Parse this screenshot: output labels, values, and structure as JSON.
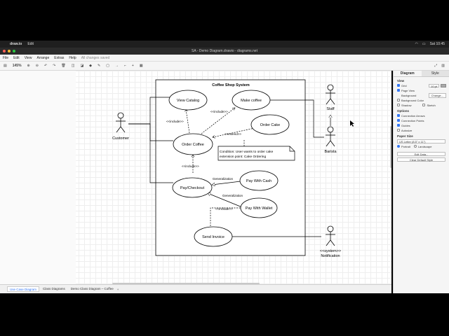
{
  "menubar": {
    "app_name": "draw.io",
    "edit": "Edit",
    "status_time": "Sat 10:45"
  },
  "window": {
    "title": "SA - Demo Diagram.drawio - diagrams.net"
  },
  "app_menu": {
    "items": [
      "File",
      "Edit",
      "View",
      "Arrange",
      "Extras",
      "Help"
    ],
    "saved": "All changes saved"
  },
  "toolbar": {
    "zoom": "145%"
  },
  "diagram": {
    "system_title": "Coffee Shop System",
    "actors": {
      "customer": "Customer",
      "staff": "Staff",
      "barista": "Barista",
      "notification_stereotype": "<<system>>",
      "notification": "Notification"
    },
    "use_cases": {
      "view_catalog": "View Catalog",
      "make_coffee": "Make coffee",
      "order_cake": "Order Cake",
      "order_coffee": "Order Coffee",
      "pay_checkout": "Pay/Checkout",
      "pay_cash": "Pay With Cash",
      "pay_wallet": "Pay With Wallet",
      "send_invoice": "Send Invoice"
    },
    "labels": {
      "include1": "<<include>>",
      "include2": "<<include>>",
      "extend": "<<extend>>",
      "include3": "<<include>>",
      "generalization1": "Generalization",
      "generalization2": "Generalization",
      "include4": "<<include>>"
    },
    "note": {
      "line1": "Condition: User wants to order cake",
      "line2": "extension point: Cake Ordering"
    }
  },
  "panel": {
    "tab_diagram": "Diagram",
    "tab_style": "Style",
    "view_heading": "View",
    "grid": "Grid",
    "grid_value": "10 pt",
    "page_view": "Page View",
    "background": "Background",
    "change": "Change...",
    "background_color": "Background Color",
    "shadow": "Shadow",
    "sketch": "Sketch",
    "options_heading": "Options",
    "connection_arrows": "Connection Arrows",
    "connection_points": "Connection Points",
    "guides": "Guides",
    "autosize": "Autosize",
    "paper_heading": "Paper Size",
    "paper_value": "US Letter (8.5\" x 11\")",
    "portrait": "Portrait",
    "landscape": "Landscape",
    "edit_data": "Edit Data...",
    "clear_style": "Clear Default Style"
  },
  "page_tabs": [
    "Use Case Diagram",
    "Class Diagrams",
    "Demo Class Diagram – Coffee"
  ],
  "colors": {
    "accent": "#3478f6",
    "stroke": "#000000"
  }
}
